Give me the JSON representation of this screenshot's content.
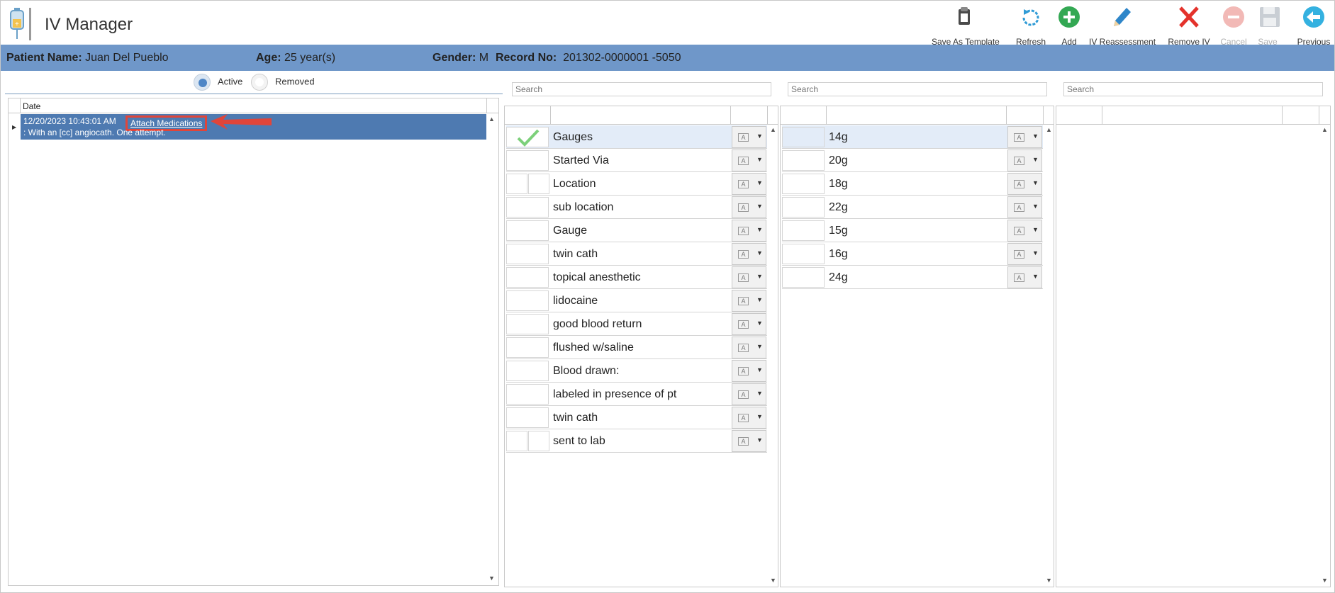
{
  "app": {
    "title": "IV Manager",
    "logo_icon": "iv-bag-icon"
  },
  "toolbar": [
    {
      "label": "Save As Template",
      "icon": "clipboard-icon",
      "enabled": true
    },
    {
      "label": "Refresh",
      "icon": "refresh-icon",
      "enabled": true
    },
    {
      "label": "Add",
      "icon": "plus-circle-icon",
      "enabled": true
    },
    {
      "label": "IV Reassessment",
      "icon": "pencil-icon",
      "enabled": true
    },
    {
      "label": "Remove IV",
      "icon": "red-x-icon",
      "enabled": true
    },
    {
      "label": "Cancel",
      "icon": "minus-circle-icon",
      "enabled": false
    },
    {
      "label": "Save",
      "icon": "floppy-disk-icon",
      "enabled": false
    },
    {
      "label": "Previous",
      "icon": "arrow-left-circle-icon",
      "enabled": true
    }
  ],
  "patient": {
    "name_label": "Patient Name:",
    "name": "Juan Del Pueblo",
    "age_label": "Age:",
    "age": "25 year(s)",
    "gender_label": "Gender:",
    "gender": "M",
    "record_label": "Record No:",
    "record": "201302-0000001 -5050"
  },
  "filter": {
    "active_label": "Active",
    "removed_label": "Removed",
    "selected": "Active"
  },
  "records": {
    "column_header": "Date",
    "rows": [
      {
        "date": "12/20/2023 10:43:01 AM",
        "link": "Attach Medications",
        "note": ": With an [cc] angiocath. One attempt."
      }
    ]
  },
  "searches": [
    {
      "placeholder": "Search"
    },
    {
      "placeholder": "Search"
    },
    {
      "placeholder": "Search"
    }
  ],
  "categories": [
    {
      "label": "Gauges",
      "checked": true,
      "split": false
    },
    {
      "label": "Started Via",
      "checked": false,
      "split": false
    },
    {
      "label": "Location",
      "checked": false,
      "split": true
    },
    {
      "label": "sub location",
      "checked": false,
      "split": false
    },
    {
      "label": "Gauge",
      "checked": false,
      "split": false
    },
    {
      "label": "twin cath",
      "checked": false,
      "split": false
    },
    {
      "label": "topical anesthetic",
      "checked": false,
      "split": false
    },
    {
      "label": "lidocaine",
      "checked": false,
      "split": false
    },
    {
      "label": "good blood return",
      "checked": false,
      "split": false
    },
    {
      "label": "flushed w/saline",
      "checked": false,
      "split": false
    },
    {
      "label": "Blood drawn:",
      "checked": false,
      "split": false
    },
    {
      "label": "labeled in presence of pt",
      "checked": false,
      "split": false
    },
    {
      "label": "twin cath",
      "checked": false,
      "split": false
    },
    {
      "label": "sent to lab",
      "checked": false,
      "split": true
    }
  ],
  "gauge_values": [
    {
      "label": "14g"
    },
    {
      "label": "20g"
    },
    {
      "label": "18g"
    },
    {
      "label": "22g"
    },
    {
      "label": "15g"
    },
    {
      "label": "16g"
    },
    {
      "label": "24g"
    }
  ],
  "colors": {
    "header_bar": "#6f97c9",
    "selected_row": "#4e7ab1",
    "callout": "#e0453a"
  }
}
